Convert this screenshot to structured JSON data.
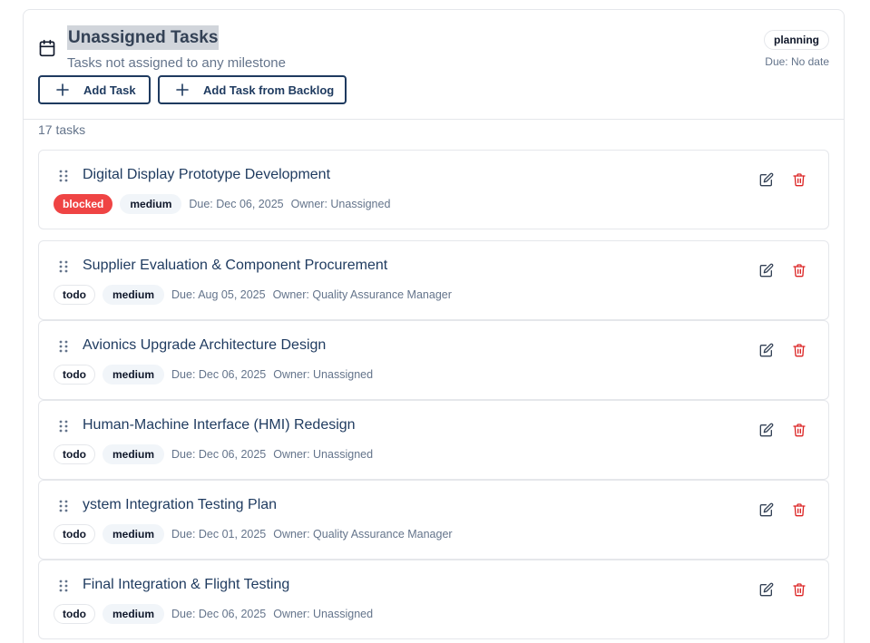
{
  "header": {
    "icon": "calendar-icon",
    "title": "Unassigned Tasks",
    "subtitle": "Tasks not assigned to any milestone",
    "add_task_label": "Add Task",
    "add_backlog_label": "Add Task from Backlog",
    "status": "planning",
    "due": "Due: No date"
  },
  "task_count": "17 tasks",
  "colors": {
    "accent": "#1e3a5f",
    "blocked": "#ef4444",
    "delete": "#dc2626"
  },
  "tasks": [
    {
      "title": "Digital Display Prototype Development",
      "status": "blocked",
      "priority": "medium",
      "due": "Due: Dec 06, 2025",
      "owner": "Owner: Unassigned"
    },
    {
      "title": "Supplier Evaluation & Component Procurement",
      "status": "todo",
      "priority": "medium",
      "due": "Due: Aug 05, 2025",
      "owner": "Owner: Quality Assurance Manager"
    },
    {
      "title": "Avionics Upgrade Architecture Design",
      "status": "todo",
      "priority": "medium",
      "due": "Due: Dec 06, 2025",
      "owner": "Owner: Unassigned"
    },
    {
      "title": "Human-Machine Interface (HMI) Redesign",
      "status": "todo",
      "priority": "medium",
      "due": "Due: Dec 06, 2025",
      "owner": "Owner: Unassigned"
    },
    {
      "title": "ystem Integration Testing Plan",
      "status": "todo",
      "priority": "medium",
      "due": "Due: Dec 01, 2025",
      "owner": "Owner: Quality Assurance Manager"
    },
    {
      "title": "Final Integration & Flight Testing",
      "status": "todo",
      "priority": "medium",
      "due": "Due: Dec 06, 2025",
      "owner": "Owner: Unassigned"
    }
  ]
}
